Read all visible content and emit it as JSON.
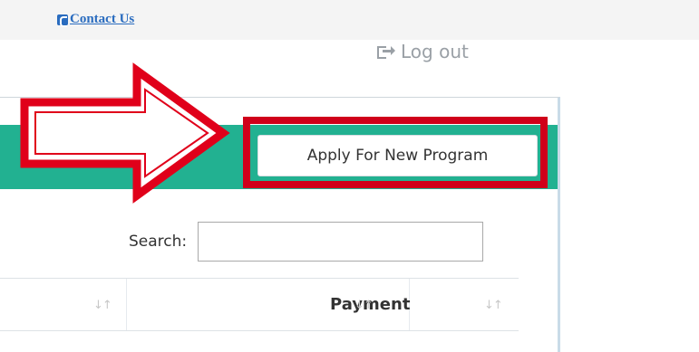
{
  "topbar": {
    "contact_label": "Contact Us"
  },
  "header": {
    "logout_label": "Log out"
  },
  "panel": {
    "apply_button_label": "Apply For New Program"
  },
  "search": {
    "label": "Search:",
    "value": ""
  },
  "table": {
    "columns": [
      "",
      "Payment",
      ""
    ]
  },
  "colors": {
    "header_green": "#22b191",
    "highlight_red": "#d0001a",
    "link_blue": "#2a6cbf"
  },
  "icons": {
    "contact": "phone-icon",
    "logout": "logout-icon",
    "sort": "sort-icon",
    "list": "list-icon",
    "arrow": "arrow-annotation-icon"
  }
}
